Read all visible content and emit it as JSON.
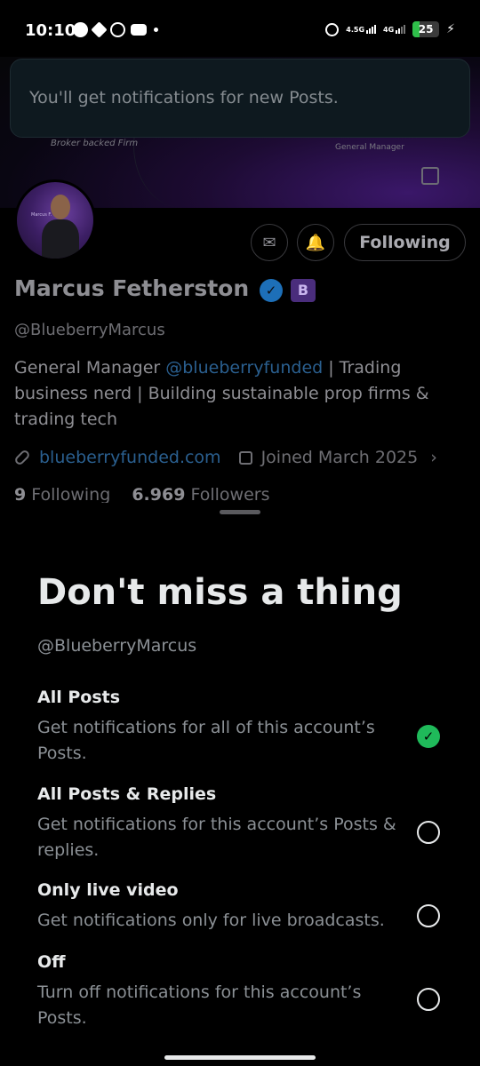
{
  "status_bar": {
    "time": "10:10",
    "network_top": "4.5G",
    "network_2": "4G",
    "battery": "25",
    "battery_level_percent": 25
  },
  "toast": {
    "message": "You'll get notifications for new Posts."
  },
  "profile": {
    "banner_text_left": "Broker backed Firm",
    "banner_text_right": "General Manager",
    "avatar_caption": "Marcus F.",
    "name": "Marcus Fetherston",
    "verified_icon": "check",
    "affiliate_badge": "B",
    "handle": "@BlueberryMarcus",
    "bio_prefix": "General  Manager ",
    "bio_mention": "@blueberryfunded",
    "bio_suffix": " | Trading business nerd | Building sustainable prop firms & trading tech",
    "website": "blueberryfunded.com",
    "joined": "Joined March 2025",
    "following_count": "9",
    "following_label": "Following",
    "followers_count": "6.969",
    "followers_label": "Followers",
    "follow_button": "Following",
    "message_icon": "envelope-icon",
    "bell_icon": "bell-check-icon"
  },
  "sheet": {
    "title": "Don't miss a thing",
    "handle": "@BlueberryMarcus",
    "options": [
      {
        "title": "All Posts",
        "desc": "Get notifications for all of this account’s Posts.",
        "selected": true
      },
      {
        "title": "All Posts & Replies",
        "desc": "Get notifications for this account’s Posts & replies.",
        "selected": false
      },
      {
        "title": "Only live video",
        "desc": "Get notifications only for live broadcasts.",
        "selected": false
      },
      {
        "title": "Off",
        "desc": "Turn off notifications for this account’s Posts.",
        "selected": false
      }
    ]
  },
  "colors": {
    "accent_green": "#1fba5a",
    "link_blue": "#1d9bf0",
    "verified_blue": "#1d9bf0"
  }
}
